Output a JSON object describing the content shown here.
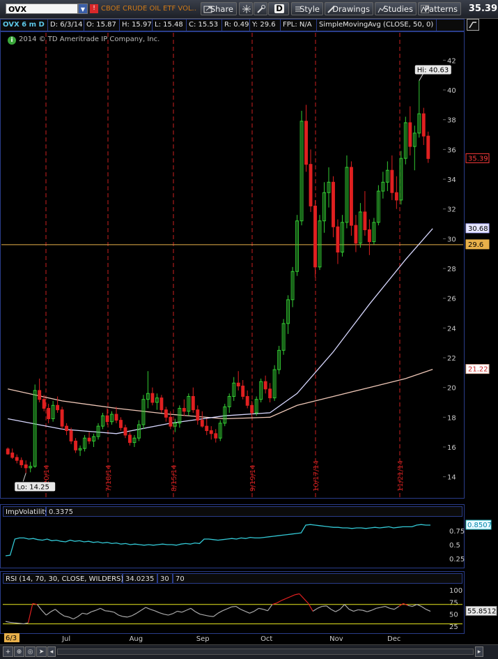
{
  "toolbar": {
    "symbol": "OVX",
    "symbol_description": "CBOE CRUDE OIL ETF VOL...",
    "share_label": "Share",
    "aggregation_label": "D",
    "style_label": "Style",
    "drawings_label": "Drawings",
    "studies_label": "Studies",
    "patterns_label": "Patterns",
    "last_price": "35.39"
  },
  "header": {
    "title": "OVX 6 m D",
    "date": "D: 6/3/14",
    "open": "O: 15.87",
    "high": "H: 15.97",
    "low": "L: 15.48",
    "close": "C: 15.53",
    "range": "R: 0.49",
    "y": "Y: 29.6",
    "fpl": "FPL: N/A",
    "study": "SimpleMovingAvg (CLOSE, 50, 0)"
  },
  "main_chart": {
    "copyright": "2014 © TD Ameritrade IP Company, Inc.",
    "hi_label": "Hi: 40.63",
    "lo_label": "Lo: 14.25",
    "price_tags": [
      {
        "label": "35.39",
        "value": 35.39,
        "bg": "#000000",
        "fg": "#ff3b3b",
        "border": "#ff3b3b"
      },
      {
        "label": "30.68",
        "value": 30.68,
        "bg": "#e6e6ff",
        "fg": "#000000",
        "border": "#b0b0ff"
      },
      {
        "label": "29.6",
        "value": 29.6,
        "bg": "#e8b04a",
        "fg": "#000000",
        "border": "#e8b04a"
      },
      {
        "label": "21.22",
        "value": 21.22,
        "bg": "#ffffff",
        "fg": "#cc2222",
        "border": "#e0b0a0"
      }
    ],
    "event_dates": [
      "6/20/14",
      "7/18/14",
      "8/15/14",
      "9/19/14",
      "10/17/14",
      "11/21/14"
    ],
    "colors": {
      "up": "#33cc33",
      "down": "#e02020",
      "sma50": "#d8d8ff",
      "sma200": "#f0c8b8",
      "crosshair": "#e8b04a",
      "expiry": "#cc2020"
    }
  },
  "chart_data": [
    {
      "type": "candlestick",
      "title": "OVX 6 m D",
      "ylim": [
        13,
        43
      ],
      "yticks": [
        14,
        16,
        18,
        20,
        22,
        24,
        26,
        28,
        30,
        32,
        34,
        36,
        38,
        40,
        42
      ],
      "crosshair_y": 29.6,
      "ohlc": [
        [
          15.87,
          15.97,
          15.48,
          15.53
        ],
        [
          15.6,
          15.9,
          15.2,
          15.3
        ],
        [
          15.3,
          15.5,
          14.9,
          15.1
        ],
        [
          15.1,
          15.3,
          14.6,
          14.8
        ],
        [
          14.8,
          15.1,
          14.25,
          14.6
        ],
        [
          14.6,
          15,
          14.3,
          14.7
        ],
        [
          14.7,
          20.2,
          14.6,
          19.8
        ],
        [
          19.8,
          20.6,
          19,
          19.2
        ],
        [
          19.2,
          19.5,
          18.4,
          18.6
        ],
        [
          18.6,
          18.9,
          17.6,
          17.9
        ],
        [
          17.9,
          19.1,
          17.7,
          18.8
        ],
        [
          18.8,
          19.4,
          18.3,
          18.5
        ],
        [
          18.5,
          18.7,
          17.2,
          17.4
        ],
        [
          17.4,
          17.6,
          16.8,
          17.1
        ],
        [
          17.1,
          17.3,
          16.2,
          16.4
        ],
        [
          16.4,
          16.6,
          15.6,
          15.8
        ],
        [
          15.8,
          16.1,
          15.4,
          15.9
        ],
        [
          15.9,
          16.8,
          15.7,
          16.6
        ],
        [
          16.6,
          17,
          16.2,
          16.4
        ],
        [
          16.4,
          16.9,
          16,
          16.7
        ],
        [
          16.7,
          17.6,
          16.5,
          17.4
        ],
        [
          17.4,
          18.3,
          17.2,
          18.1
        ],
        [
          18.1,
          18.6,
          17.5,
          17.7
        ],
        [
          17.7,
          18.4,
          17.5,
          18.2
        ],
        [
          18.2,
          18.7,
          17.6,
          17.8
        ],
        [
          17.8,
          18,
          17.1,
          17.3
        ],
        [
          17.3,
          17.5,
          16.6,
          16.8
        ],
        [
          16.8,
          17,
          16.1,
          16.3
        ],
        [
          16.3,
          16.8,
          16,
          16.6
        ],
        [
          16.6,
          17.8,
          16.4,
          17.5
        ],
        [
          17.5,
          19.5,
          17.2,
          19.2
        ],
        [
          19.2,
          21.1,
          18.6,
          19.6
        ],
        [
          19.6,
          20,
          18.8,
          19
        ],
        [
          19,
          19.6,
          18.5,
          19.3
        ],
        [
          19.3,
          19.5,
          18.3,
          18.5
        ],
        [
          18.5,
          18.7,
          17.7,
          18
        ],
        [
          18,
          18.4,
          17.2,
          17.4
        ],
        [
          17.4,
          17.9,
          17,
          17.6
        ],
        [
          17.6,
          18.8,
          17.3,
          18.6
        ],
        [
          18.6,
          19.2,
          18.1,
          18.4
        ],
        [
          18.4,
          19.6,
          18.1,
          19.4
        ],
        [
          19.4,
          20,
          18.3,
          18.5
        ],
        [
          18.5,
          18.8,
          17.5,
          17.8
        ],
        [
          17.8,
          18.4,
          17.3,
          17.4
        ],
        [
          17.4,
          17.9,
          16.8,
          17.1
        ],
        [
          17.1,
          17.4,
          16.5,
          16.9
        ],
        [
          16.9,
          17.2,
          16.3,
          16.6
        ],
        [
          16.6,
          17.8,
          16.4,
          17.6
        ],
        [
          17.6,
          18.9,
          17.4,
          18.7
        ],
        [
          18.7,
          19.6,
          18.3,
          19.4
        ],
        [
          19.4,
          20.7,
          19.1,
          20.3
        ],
        [
          20.3,
          21.1,
          19.8,
          20.1
        ],
        [
          20.1,
          20.5,
          19.2,
          19.4
        ],
        [
          19.4,
          19.8,
          18.6,
          18.8
        ],
        [
          18.8,
          19.1,
          18,
          18.3
        ],
        [
          18.3,
          19.4,
          18.1,
          19.2
        ],
        [
          19.2,
          20.6,
          19,
          20.4
        ],
        [
          20.4,
          20.8,
          19.6,
          19.9
        ],
        [
          19.9,
          20.3,
          19,
          19.3
        ],
        [
          19.3,
          21.5,
          19.1,
          21.2
        ],
        [
          21.2,
          22.8,
          20.9,
          22.5
        ],
        [
          22.5,
          24.6,
          22.2,
          24.3
        ],
        [
          24.3,
          26.2,
          23.6,
          25.9
        ],
        [
          25.9,
          28.1,
          25.4,
          27.8
        ],
        [
          27.8,
          31.6,
          27.5,
          31.2
        ],
        [
          31.2,
          38.6,
          30.9,
          37.9
        ],
        [
          37.9,
          39,
          34.5,
          35
        ],
        [
          35,
          36,
          31.8,
          32.2
        ],
        [
          32.2,
          32.6,
          27.4,
          28.1
        ],
        [
          28.1,
          31.6,
          27.9,
          31.2
        ],
        [
          31.2,
          33.8,
          30.4,
          33.1
        ],
        [
          33.1,
          34.8,
          32.1,
          33.8
        ],
        [
          33.8,
          34.2,
          30.1,
          30.8
        ],
        [
          30.8,
          31.3,
          28.3,
          29.1
        ],
        [
          29.1,
          31.6,
          28.8,
          31.1
        ],
        [
          31.1,
          35.6,
          30.7,
          34.8
        ],
        [
          34.8,
          35.2,
          30.2,
          30.9
        ],
        [
          30.9,
          31.6,
          29.1,
          29.7
        ],
        [
          29.7,
          32.4,
          29.4,
          31.8
        ],
        [
          31.8,
          33.2,
          30.2,
          30.6
        ],
        [
          30.6,
          31.3,
          28.9,
          29.8
        ],
        [
          29.8,
          31.4,
          29.6,
          31.1
        ],
        [
          31.1,
          33.6,
          30.9,
          33.2
        ],
        [
          33.2,
          34.5,
          32.7,
          33.8
        ],
        [
          33.8,
          35.2,
          33.2,
          34.6
        ],
        [
          34.6,
          35.6,
          32.6,
          33.1
        ],
        [
          33.1,
          34.2,
          32,
          32.6
        ],
        [
          32.6,
          35.9,
          32.3,
          35.4
        ],
        [
          35.4,
          38.2,
          35,
          37.8
        ],
        [
          37.8,
          38.9,
          35.6,
          36.2
        ],
        [
          36.2,
          37.6,
          34.6,
          37.1
        ],
        [
          37.1,
          40.63,
          36.8,
          38.4
        ],
        [
          38.4,
          38.8,
          36.3,
          36.9
        ],
        [
          36.9,
          37.2,
          35.1,
          35.39
        ]
      ],
      "sma50": [
        {
          "i": 0,
          "v": 17.9
        },
        {
          "i": 12,
          "v": 17.2
        },
        {
          "i": 24,
          "v": 16.9
        },
        {
          "i": 36,
          "v": 17.6
        },
        {
          "i": 48,
          "v": 18.1
        },
        {
          "i": 58,
          "v": 18.3
        },
        {
          "i": 64,
          "v": 19.6
        },
        {
          "i": 72,
          "v": 22.4
        },
        {
          "i": 80,
          "v": 25.6
        },
        {
          "i": 88,
          "v": 28.6
        },
        {
          "i": 94,
          "v": 30.68
        }
      ],
      "sma200": [
        {
          "i": 0,
          "v": 19.9
        },
        {
          "i": 12,
          "v": 19.1
        },
        {
          "i": 24,
          "v": 18.6
        },
        {
          "i": 36,
          "v": 18.2
        },
        {
          "i": 48,
          "v": 17.9
        },
        {
          "i": 58,
          "v": 18
        },
        {
          "i": 64,
          "v": 18.8
        },
        {
          "i": 72,
          "v": 19.4
        },
        {
          "i": 80,
          "v": 20
        },
        {
          "i": 88,
          "v": 20.6
        },
        {
          "i": 94,
          "v": 21.22
        }
      ]
    },
    {
      "type": "line",
      "title": "ImpVolatility",
      "value_label": "0.3375",
      "current": "0.8507",
      "ylim": [
        0.15,
        0.95
      ],
      "yticks": [
        0.25,
        0.5,
        0.75
      ],
      "color": "#33c9d6",
      "values": [
        0.3,
        0.31,
        0.6,
        0.62,
        0.62,
        0.6,
        0.61,
        0.59,
        0.58,
        0.6,
        0.57,
        0.58,
        0.56,
        0.55,
        0.58,
        0.56,
        0.57,
        0.55,
        0.56,
        0.54,
        0.55,
        0.53,
        0.54,
        0.52,
        0.53,
        0.51,
        0.52,
        0.5,
        0.51,
        0.5,
        0.49,
        0.5,
        0.49,
        0.5,
        0.51,
        0.5,
        0.5,
        0.49,
        0.51,
        0.52,
        0.51,
        0.53,
        0.52,
        0.6,
        0.6,
        0.59,
        0.58,
        0.59,
        0.6,
        0.61,
        0.6,
        0.62,
        0.61,
        0.63,
        0.62,
        0.62,
        0.63,
        0.64,
        0.65,
        0.66,
        0.67,
        0.68,
        0.69,
        0.7,
        0.71,
        0.85,
        0.86,
        0.85,
        0.84,
        0.83,
        0.82,
        0.81,
        0.81,
        0.8,
        0.8,
        0.79,
        0.8,
        0.8,
        0.79,
        0.8,
        0.81,
        0.8,
        0.81,
        0.82,
        0.8,
        0.81,
        0.82,
        0.82,
        0.82,
        0.85,
        0.86,
        0.85,
        0.85
      ]
    },
    {
      "type": "line",
      "title": "RSI (14, 70, 30, CLOSE, WILDERS)",
      "value_label": "34.0235",
      "oversold": "30",
      "overbought": "70",
      "current": "55.8512",
      "ylim": [
        15,
        110
      ],
      "yticks": [
        25,
        50,
        75,
        100
      ],
      "colors": {
        "normal": "#aaaaaa",
        "overbought": "#e02020",
        "levels": "#e8e820"
      },
      "values": [
        35,
        33,
        32,
        31,
        30,
        32,
        72,
        70,
        58,
        48,
        55,
        60,
        52,
        46,
        44,
        40,
        45,
        52,
        50,
        55,
        58,
        62,
        57,
        56,
        54,
        48,
        45,
        44,
        47,
        52,
        58,
        64,
        60,
        57,
        53,
        50,
        48,
        51,
        56,
        54,
        58,
        62,
        55,
        50,
        48,
        46,
        45,
        52,
        57,
        61,
        65,
        66,
        60,
        56,
        52,
        56,
        62,
        60,
        57,
        70,
        73,
        78,
        82,
        86,
        90,
        92,
        82,
        72,
        56,
        62,
        66,
        67,
        60,
        55,
        60,
        70,
        60,
        56,
        59,
        58,
        55,
        58,
        62,
        64,
        66,
        62,
        60,
        66,
        72,
        68,
        66,
        70,
        66,
        60,
        56
      ]
    }
  ],
  "x_axis": {
    "start_label": "6/3",
    "labels": [
      {
        "label": "Jul",
        "i": 20
      },
      {
        "label": "Aug",
        "i": 43
      },
      {
        "label": "Sep",
        "i": 65
      },
      {
        "label": "Oct",
        "i": 86
      },
      {
        "label": "Nov",
        "i": 109
      },
      {
        "label": "Dec",
        "i": 128
      }
    ]
  }
}
